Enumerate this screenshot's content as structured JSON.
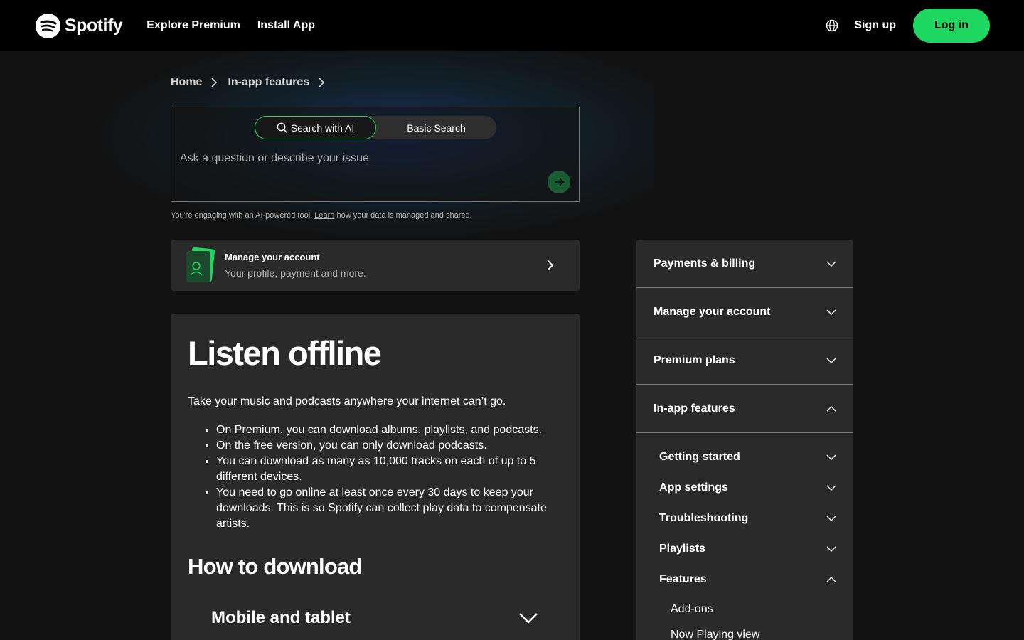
{
  "header": {
    "logo_text": "Spotify",
    "nav": [
      {
        "label": "Explore Premium"
      },
      {
        "label": "Install App"
      }
    ],
    "signup_label": "Sign up",
    "login_label": "Log in",
    "accent_color": "#1ed760"
  },
  "breadcrumb": {
    "items": [
      "Home",
      "In-app features"
    ]
  },
  "search": {
    "tab_ai": "Search with AI",
    "tab_basic": "Basic Search",
    "placeholder": "Ask a question or describe your issue",
    "disclaimer_before": "You're engaging with an AI-powered tool. ",
    "disclaimer_link": "Learn",
    "disclaimer_after": " how your data is managed and shared."
  },
  "manage_card": {
    "title": "Manage your account",
    "subtitle": "Your profile, payment and more."
  },
  "article": {
    "title": "Listen offline",
    "intro": "Take your music and podcasts anywhere your internet can’t go.",
    "bullets": [
      "On Premium, you can download albums, playlists, and podcasts.",
      "On the free version, you can only download podcasts.",
      "You can download as many as 10,000 tracks on each of up to 5 different devices.",
      "You need to go online at least once every 30 days to keep your downloads. This is so Spotify can collect play data to compensate artists."
    ],
    "section_heading": "How to download",
    "accordion_label": "Mobile and tablet"
  },
  "sidebar": {
    "sections": [
      {
        "label": "Payments & billing",
        "expanded": false
      },
      {
        "label": "Manage your account",
        "expanded": false
      },
      {
        "label": "Premium plans",
        "expanded": false
      },
      {
        "label": "In-app features",
        "expanded": true
      }
    ],
    "subsections": [
      {
        "label": "Getting started",
        "expanded": false
      },
      {
        "label": "App settings",
        "expanded": false
      },
      {
        "label": "Troubleshooting",
        "expanded": false
      },
      {
        "label": "Playlists",
        "expanded": false
      },
      {
        "label": "Features",
        "expanded": true
      }
    ],
    "feature_items": [
      "Add-ons",
      "Now Playing view"
    ]
  }
}
